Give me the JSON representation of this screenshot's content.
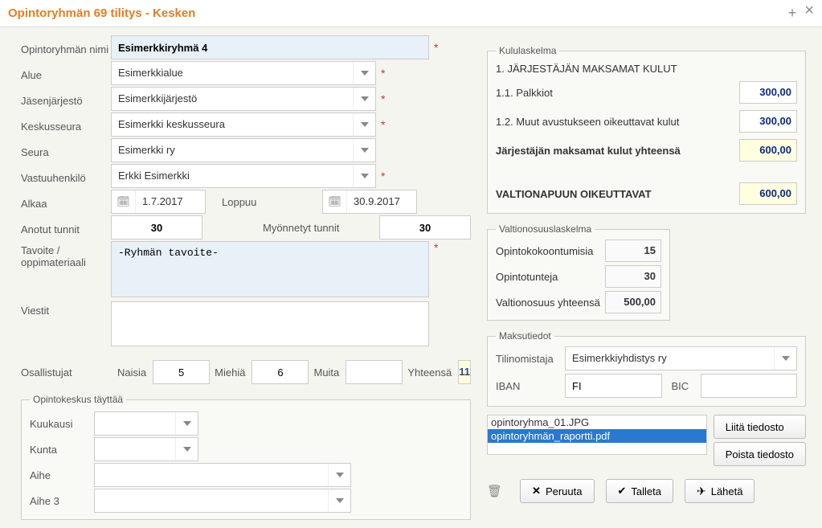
{
  "window": {
    "title": "Opintoryhmän 69 tilitys - Kesken"
  },
  "form": {
    "group_name_label": "Opintoryhmän nimi",
    "group_name": "Esimerkkiryhmä 4",
    "region_label": "Alue",
    "region": "Esimerkkialue",
    "member_org_label": "Jäsenjärjestö",
    "member_org": "Esimerkkijärjestö",
    "central_assoc_label": "Keskusseura",
    "central_assoc": "Esimerkki keskusseura",
    "club_label": "Seura",
    "club": "Esimerkki ry",
    "responsible_label": "Vastuuhenkilö",
    "responsible": "Erkki Esimerkki",
    "start_label": "Alkaa",
    "start_date": "1.7.2017",
    "end_label": "Loppuu",
    "end_date": "30.9.2017",
    "requested_hours_label": "Anotut tunnit",
    "requested_hours": "30",
    "granted_hours_label": "Myönnetyt tunnit",
    "granted_hours": "30",
    "goal_label": "Tavoite / oppimateriaali",
    "goal_text": "-Ryhmän tavoite-",
    "messages_label": "Viestit",
    "messages_text": ""
  },
  "participants": {
    "label": "Osallistujat",
    "women_label": "Naisia",
    "women": "5",
    "men_label": "Miehiä",
    "men": "6",
    "other_label": "Muita",
    "other": "",
    "total_label": "Yhteensä",
    "total": "11"
  },
  "office_fieldset": {
    "legend": "Opintokeskus täyttää",
    "month_label": "Kuukausi",
    "municipality_label": "Kunta",
    "topic_label": "Aihe",
    "topic3_label": "Aihe 3"
  },
  "costs": {
    "legend": "Kululaskelma",
    "section1": "1. JÄRJESTÄJÄN MAKSAMAT KULUT",
    "fees_label": "1.1. Palkkiot",
    "fees_value": "300,00",
    "other_eligible_label": "1.2. Muut avustukseen oikeuttavat kulut",
    "other_eligible_value": "300,00",
    "org_total_label": "Järjestäjän maksamat kulut yhteensä",
    "org_total_value": "600,00",
    "state_aid_label": "VALTIONAPUUN OIKEUTTAVAT",
    "state_aid_value": "600,00"
  },
  "state_share": {
    "legend": "Valtionosuuslaskelma",
    "meetings_label": "Opintokokoontumisia",
    "meetings_value": "15",
    "hours_label": "Opintotunteja",
    "hours_value": "30",
    "total_label": "Valtionosuus yhteensä",
    "total_value": "500,00"
  },
  "payment": {
    "legend": "Maksutiedot",
    "account_owner_label": "Tilinomistaja",
    "account_owner": "Esimerkkiyhdistys ry",
    "iban_label": "IBAN",
    "iban_value": "FI",
    "bic_label": "BIC",
    "bic_value": ""
  },
  "files": {
    "list": [
      "opintoryhma_01.JPG",
      "opintoryhmän_raportti.pdf"
    ],
    "selected_index": 1,
    "attach_label": "Liitä tiedosto",
    "remove_label": "Poista tiedosto"
  },
  "actions": {
    "cancel": "Peruuta",
    "save": "Talleta",
    "send": "Lähetä"
  }
}
